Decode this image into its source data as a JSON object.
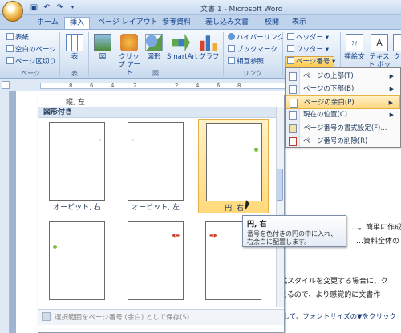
{
  "app": {
    "title": "文書 1 - Microsoft Word",
    "qat": [
      "save-icon",
      "undo-icon",
      "redo-icon"
    ]
  },
  "tabs": [
    "ホーム",
    "挿入",
    "ページ レイアウト",
    "参考資料",
    "差し込み文書",
    "校閲",
    "表示"
  ],
  "active_tab": "挿入",
  "ribbon": {
    "pages_group": {
      "items": [
        "表紙",
        "空白のページ",
        "ページ区切り"
      ],
      "label": "ページ"
    },
    "table": {
      "label": "表",
      "group": "表"
    },
    "illustrations": {
      "items": [
        "図",
        "クリップ アート",
        "図形",
        "SmartArt",
        "グラフ"
      ],
      "label": "図"
    },
    "links": {
      "items": [
        "ハイパーリンク",
        "ブックマーク",
        "相互参照"
      ],
      "label": "リンク"
    },
    "header_footer": {
      "items": [
        "ヘッダー",
        "フッター",
        "ページ番号"
      ]
    },
    "text": {
      "items": [
        "挿絵文",
        "テキスト ボックス",
        "ク"
      ]
    }
  },
  "ruler": {
    "ticks": [
      "8",
      "6",
      "4",
      "2",
      "2",
      "4",
      "6",
      "8"
    ]
  },
  "menu": {
    "items": [
      {
        "label": "ページの上部(T)",
        "submenu": true
      },
      {
        "label": "ページの下部(B)",
        "submenu": true
      },
      {
        "label": "ページの余白(P)",
        "submenu": true,
        "highlighted": true
      },
      {
        "label": "現在の位置(C)",
        "submenu": true
      },
      {
        "label": "ページ番号の書式設定(F)...",
        "submenu": false
      },
      {
        "label": "ページ番号の削除(R)",
        "submenu": false
      }
    ]
  },
  "gallery": {
    "prev_caption": "縦, 左",
    "section_header": "図形付き",
    "tiles": [
      {
        "label": "オービット, 右",
        "selected": false,
        "mark": "none"
      },
      {
        "label": "オービット, 左",
        "selected": false,
        "mark": "none"
      },
      {
        "label": "円, 右",
        "selected": true,
        "mark": "dot-right"
      },
      {
        "label": "",
        "selected": false,
        "mark": "dot-left"
      },
      {
        "label": "",
        "selected": false,
        "mark": "arrow-right"
      },
      {
        "label": "",
        "selected": false,
        "mark": "arrow-left"
      }
    ],
    "footer": "選択範囲をページ番号 (余白) として保存(S)"
  },
  "tooltip": {
    "title": "円, 右",
    "body": "番号を色付きの円の中に入れ、右余白に配置します。"
  },
  "document": {
    "lines": [
      "…。簡単に作成す",
      "…資料全体の",
      "書式スタイルを変更する場合に、ク",
      "行えるので、より感覚的に文書作",
      "択して、フォントサイズの▼をクリック"
    ]
  },
  "colors": {
    "accent": "#ffd57e",
    "tab_text": "#15428b",
    "dot": "#7cc043",
    "arrow": "#d03a2a"
  }
}
